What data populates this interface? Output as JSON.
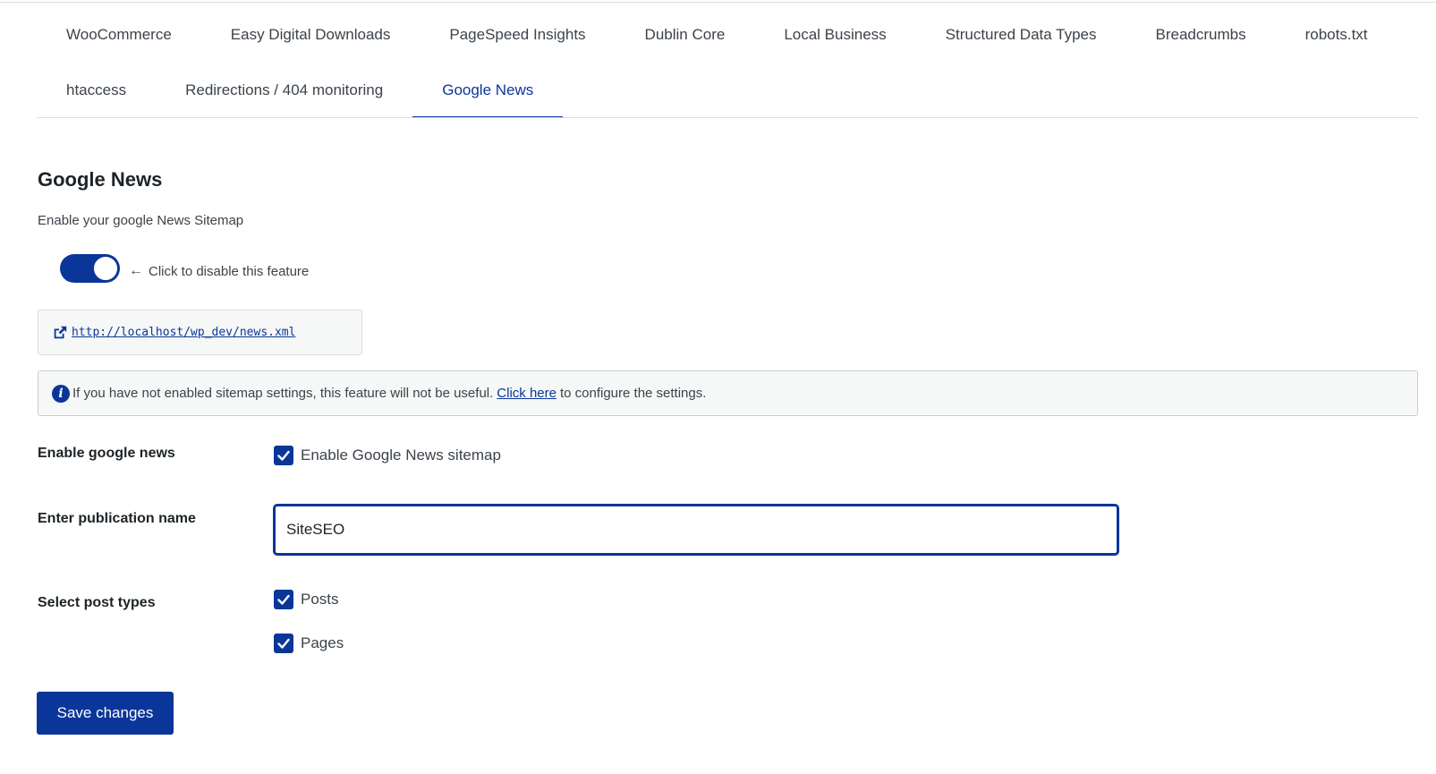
{
  "tabs": {
    "row1": [
      "WooCommerce",
      "Easy Digital Downloads",
      "PageSpeed Insights",
      "Dublin Core",
      "Local Business",
      "Structured Data Types",
      "Breadcrumbs",
      "robots.txt"
    ],
    "row2": [
      "htaccess",
      "Redirections / 404 monitoring",
      "Google News"
    ],
    "active": "Google News"
  },
  "section": {
    "title": "Google News",
    "description": "Enable your google News Sitemap"
  },
  "toggle": {
    "enabled": true,
    "hint": "Click to disable this feature"
  },
  "sitemap_url": "http://localhost/wp_dev/news.xml",
  "notice": {
    "text_before": "If you have not enabled sitemap settings, this feature will not be useful.",
    "link": "Click here",
    "text_after": "to configure the settings."
  },
  "fields": {
    "enable_news": {
      "label": "Enable google news",
      "checkbox_label": "Enable Google News sitemap",
      "checked": true
    },
    "publication": {
      "label": "Enter publication name",
      "value": "SiteSEO"
    },
    "post_types": {
      "label": "Select post types",
      "options": [
        {
          "label": "Posts",
          "checked": true
        },
        {
          "label": "Pages",
          "checked": true
        }
      ]
    }
  },
  "save_label": "Save changes",
  "colors": {
    "accent": "#0b3699",
    "text": "#3c434a",
    "notice_bg": "#f6f7f7"
  }
}
